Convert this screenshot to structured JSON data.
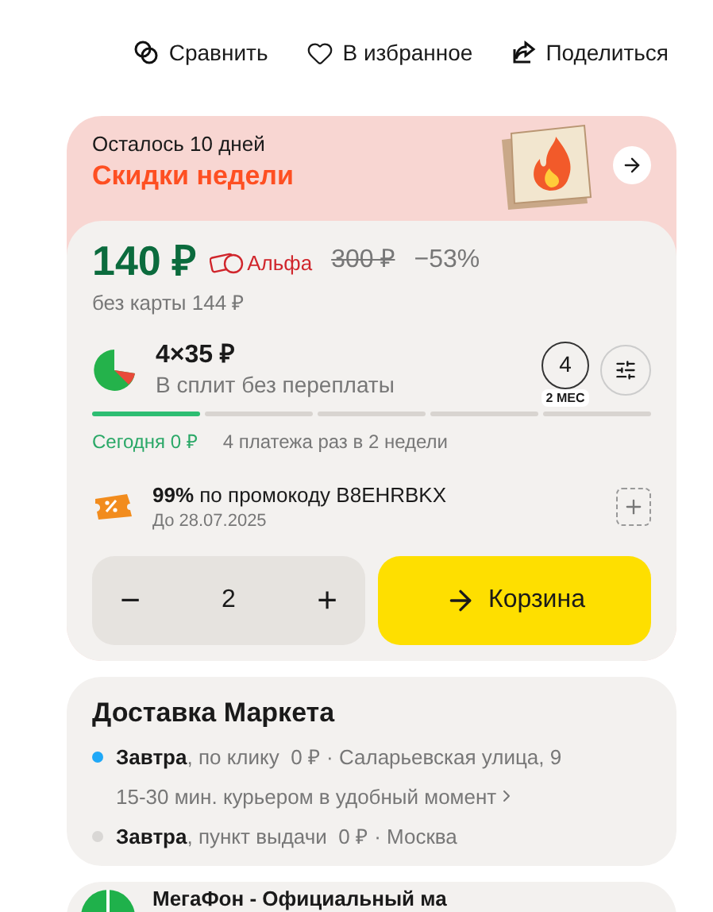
{
  "actions": [
    {
      "kind": "compare",
      "label": "Сравнить"
    },
    {
      "kind": "favorite",
      "label": "В избранное"
    },
    {
      "kind": "share",
      "label": "Поделиться"
    }
  ],
  "promo_banner": {
    "caption": "Осталось 10 дней",
    "title": "Скидки недели"
  },
  "price": {
    "current": "140 ₽",
    "bank": "Альфа",
    "old": "300 ₽",
    "discount": "−53%",
    "without_card": "без карты 144 ₽"
  },
  "split": {
    "amount": "4×35 ₽",
    "caption": "В сплит без переплаты",
    "months": "4",
    "months_label": "2 МЕС",
    "today": "Сегодня 0 ₽",
    "schedule": "4 платежа раз в 2 недели",
    "steps": [
      {
        "active": true
      },
      {
        "active": false
      },
      {
        "active": false
      },
      {
        "active": false
      },
      {
        "active": false
      }
    ]
  },
  "coupon": {
    "text": "**99%** по промокоду B8EHRBKX",
    "expires": "До 28.07.2025"
  },
  "quantity": {
    "minus": "−",
    "value": "2",
    "plus": "+"
  },
  "cart_button": "Корзина",
  "delivery": {
    "title": "Доставка Маркета",
    "options": [
      {
        "color": "#1fa8f7",
        "text": "**Завтра**, по клику  0 ₽ · Саларьевская улица, 9",
        "detail": "15-30 мин. курьером в удобный момент"
      },
      {
        "color": "#d9d7d5",
        "text": "**Завтра**, пункт выдачи  0 ₽ · Москва"
      }
    ]
  },
  "seller": {
    "name": "МегаФон - Официальный ма"
  }
}
